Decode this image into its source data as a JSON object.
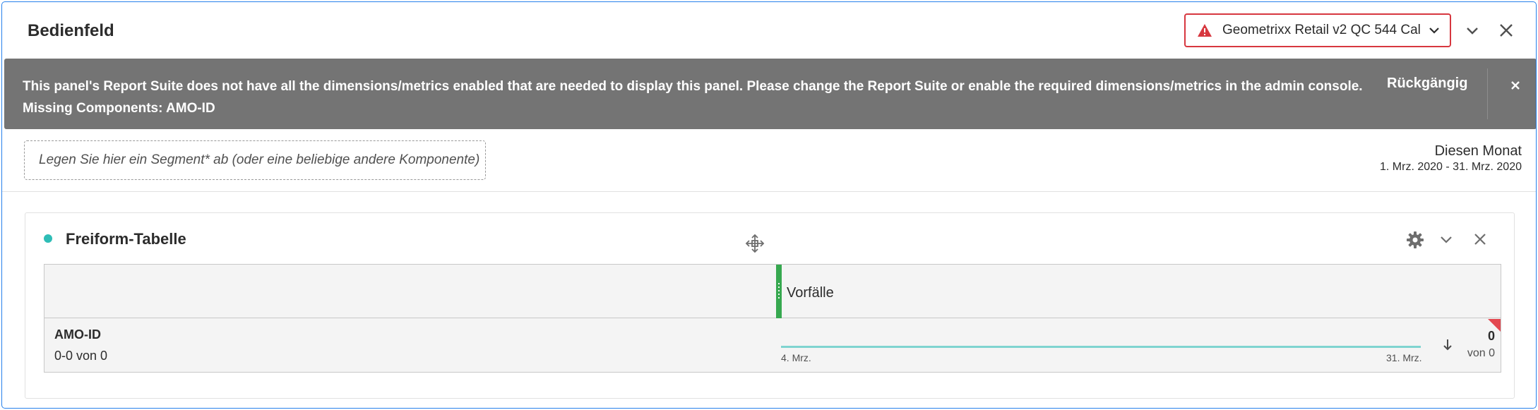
{
  "panel": {
    "title": "Bedienfeld",
    "report_suite": "Geometrixx Retail v2 QC 544 Cal"
  },
  "alert": {
    "message_line1": "This panel's Report Suite does not have all the dimensions/metrics enabled that are needed to display this panel. Please change the Report Suite or enable the required dimensions/metrics in the admin console.",
    "message_line2": "Missing Components: AMO-ID",
    "undo_label": "Rückgängig",
    "background_color": "#747474"
  },
  "dropzone": {
    "placeholder": "Legen Sie hier ein Segment* ab (oder eine beliebige andere Komponente)"
  },
  "date": {
    "title": "Diesen Monat",
    "range": "1. Mrz. 2020 - 31. Mrz. 2020"
  },
  "freeform": {
    "title": "Freiform-Tabelle",
    "metric_header": "Vorfälle",
    "dimension": "AMO-ID",
    "count_text": "0-0 von 0",
    "sparkline_start": "4. Mrz.",
    "sparkline_end": "31. Mrz.",
    "value": "0",
    "value_of": "von 0",
    "accent_color": "#2ebdb6",
    "handle_color": "#36a84f"
  },
  "icons": {
    "warning": "alert-triangle-icon",
    "chevron": "chevron-down-icon",
    "close": "close-icon",
    "move": "move-icon",
    "settings": "gear-icon",
    "sort": "arrow-down-icon"
  }
}
